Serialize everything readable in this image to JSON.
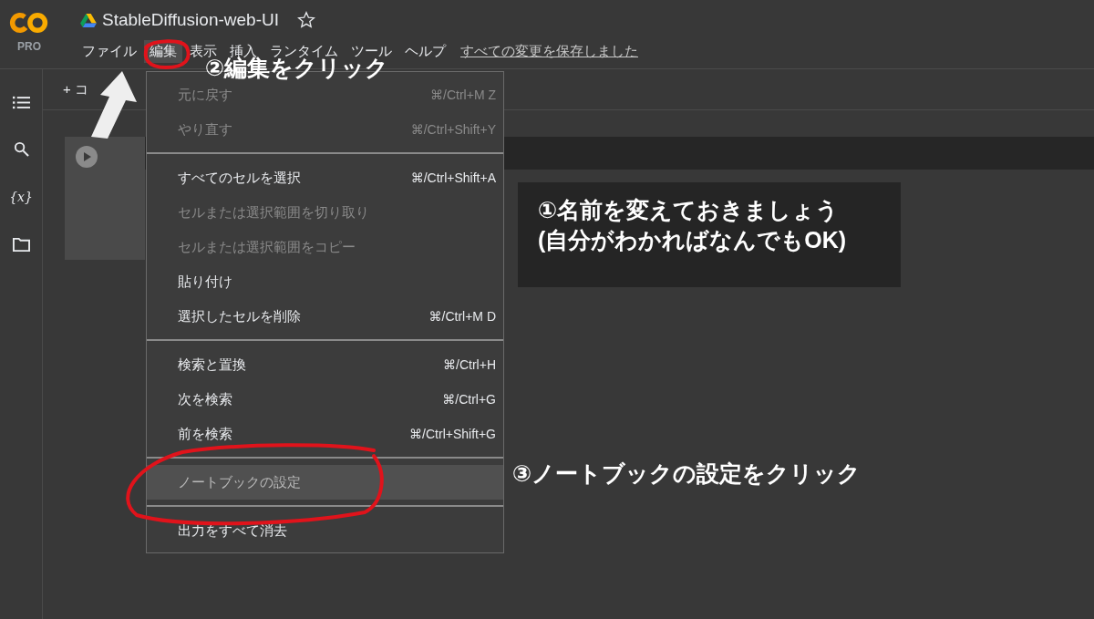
{
  "header": {
    "logo_tier": "PRO",
    "title": "StableDiffusion-web-UI",
    "starred": false
  },
  "menubar": [
    {
      "label": "ファイル",
      "selected": false
    },
    {
      "label": "編集",
      "selected": true
    },
    {
      "label": "表示",
      "selected": false
    },
    {
      "label": "挿入",
      "selected": false
    },
    {
      "label": "ランタイム",
      "selected": false
    },
    {
      "label": "ツール",
      "selected": false
    },
    {
      "label": "ヘルプ",
      "selected": false
    }
  ],
  "save_status": "すべての変更を保存しました",
  "sidebar": {
    "variables_label": "{x}"
  },
  "toolbar": {
    "add_code": "+ コ"
  },
  "edit_menu": [
    [
      {
        "label": "元に戻す",
        "shortcut": "⌘/Ctrl+M Z",
        "disabled": true,
        "highlighted": false
      },
      {
        "label": "やり直す",
        "shortcut": "⌘/Ctrl+Shift+Y",
        "disabled": true,
        "highlighted": false
      }
    ],
    [
      {
        "label": "すべてのセルを選択",
        "shortcut": "⌘/Ctrl+Shift+A",
        "disabled": false,
        "highlighted": false
      },
      {
        "label": "セルまたは選択範囲を切り取り",
        "disabled": true,
        "highlighted": false
      },
      {
        "label": "セルまたは選択範囲をコピー",
        "disabled": true,
        "highlighted": false
      },
      {
        "label": "貼り付け",
        "disabled": false,
        "highlighted": false
      },
      {
        "label": "選択したセルを削除",
        "shortcut": "⌘/Ctrl+M D",
        "disabled": false,
        "highlighted": false
      }
    ],
    [
      {
        "label": "検索と置換",
        "shortcut": "⌘/Ctrl+H",
        "disabled": false,
        "highlighted": false
      },
      {
        "label": "次を検索",
        "shortcut": "⌘/Ctrl+G",
        "disabled": false,
        "highlighted": false
      },
      {
        "label": "前を検索",
        "shortcut": "⌘/Ctrl+Shift+G",
        "disabled": false,
        "highlighted": false
      }
    ],
    [
      {
        "label": "ノートブックの設定",
        "disabled": false,
        "highlighted": true
      }
    ],
    [
      {
        "label": "出力をすべて消去",
        "disabled": false,
        "highlighted": false
      }
    ]
  ],
  "annotations": [
    {
      "kind": "plain",
      "lines": [
        "②編集をクリック"
      ]
    },
    {
      "kind": "boxed",
      "lines": [
        "①名前を変えておきましょう",
        "(自分がわかればなんでもOK)"
      ]
    },
    {
      "kind": "plain",
      "lines": [
        "③ノートブックの設定をクリック"
      ]
    }
  ]
}
